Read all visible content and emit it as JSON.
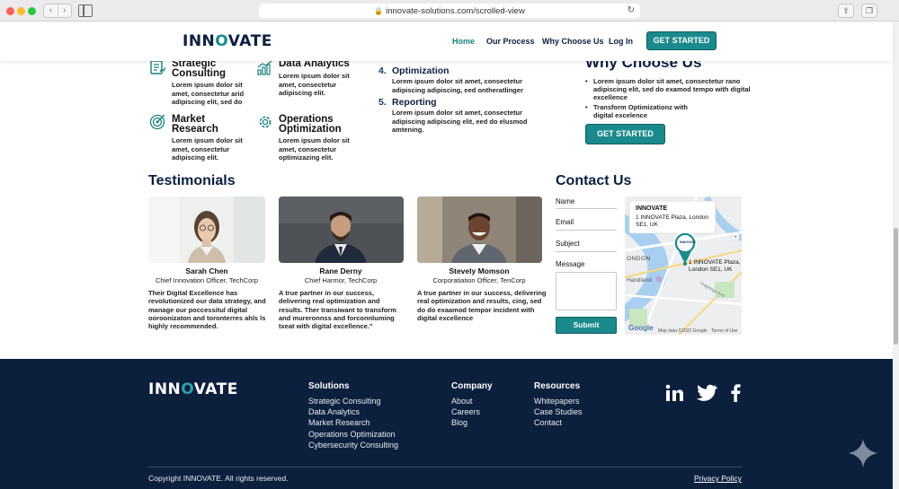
{
  "browser": {
    "url": "innovate-solutions.com/scrolled-view"
  },
  "header": {
    "logo": {
      "pre": "INN",
      "o": "O",
      "post": "VATE"
    },
    "nav": [
      "Home",
      "Our Process",
      "Why Choose Us",
      "Log In"
    ],
    "active_nav": "Home",
    "cta": "GET STARTED"
  },
  "services": [
    {
      "title": "Strategic Consulting",
      "text": "Lorem ipsum dolor sit amet, consectetur arid adipiscing elit, sed do",
      "icon": "document-chart-icon"
    },
    {
      "title": "Data Analytics",
      "text": "Lorem ipsum dolor sit amet, consectetur adipiscing elit.",
      "icon": "bar-chart-icon"
    },
    {
      "title": "Market Research",
      "text": "Lorem ipsum dolor sit amet, consectetur adipiscing elit.",
      "icon": "target-icon"
    },
    {
      "title": "Operations Optimization",
      "text": "Lorem ipsum dolor sit amet, consectetur optimizazing elit.",
      "icon": "gear-icon"
    }
  ],
  "process_steps": [
    {
      "num": "4.",
      "title": "Optimization",
      "text": "Lorem ipsum dolor sit amet, consectetur adipiscing adipiscing, eed ontheratlinger"
    },
    {
      "num": "5.",
      "title": "Reporting",
      "text": "Lorem ipsum dolor sit amet, consectetur adipiscing adipiscing elit, eed do elusmod amtening."
    }
  ],
  "why": {
    "title": "Why Choose Us",
    "items": [
      "Lorem ipsum dolor sit amet, consectetur rano adipiscing elit, sed do examod tempo with digital excellence",
      "Transform Optimizationz with digital excelence"
    ],
    "button": "GET STARTED"
  },
  "testimonials": {
    "title": "Testimonials",
    "items": [
      {
        "name": "Sarah Chen",
        "role": "Chief Innovation Officer, TechCorp",
        "quote": "Their Digital Excellence has revolutionized our data strategy, and manage our poccessitul digital ooroonizaton and toronterres ahls ls highly recommended."
      },
      {
        "name": "Rane Derny",
        "role": "Chief Harmor, TechCorp",
        "quote": "A true partner in our success, delivering real optimization and results. Ther transiwant to transform and mureronnss and forconnluming txeat with digital excellence.\""
      },
      {
        "name": "Stevely Momson",
        "role": "Corporatiation Officer, TenCorp",
        "quote": "A true partner in our success, delivering real optimization and results, cing, sed do do exaamod tempor incident with digital excellence"
      }
    ]
  },
  "contact": {
    "title": "Contact Us",
    "fields": [
      "Name",
      "Email",
      "Subject",
      "Message"
    ],
    "submit": "Submit",
    "map": {
      "card_title": "INNOVATE",
      "card_address": "1 INNOVATE Plaza, London SE1, UK",
      "pin_label": "INNOVATE",
      "address_label": "1 INNOVATE Plaza, London SE1, UK",
      "places": [
        "ONDON",
        "Handland",
        "Uraghtage Brid"
      ],
      "attribution": "Map data ©2022 Google",
      "terms": "Terms of Use",
      "google": "Google"
    }
  },
  "footer": {
    "logo": {
      "pre": "INN",
      "o": "O",
      "post": "VATE"
    },
    "columns": [
      {
        "title": "Solutions",
        "links": [
          "Strategic Consulting",
          "Data Analytics",
          "Market Research",
          "Operations Optimization",
          "Cybersecurity Consulting"
        ]
      },
      {
        "title": "Company",
        "links": [
          "About",
          "Careers",
          "Blog"
        ]
      },
      {
        "title": "Resources",
        "links": [
          "Whitepapers",
          "Case Studies",
          "Contact"
        ]
      }
    ],
    "social": [
      "linkedin-icon",
      "twitter-icon",
      "facebook-icon"
    ],
    "copyright": "Copyright INNOVATE. All rights reserved.",
    "privacy": "Privacy Policy"
  },
  "colors": {
    "teal": "#1a8a8c",
    "navy": "#0c1f3d"
  }
}
